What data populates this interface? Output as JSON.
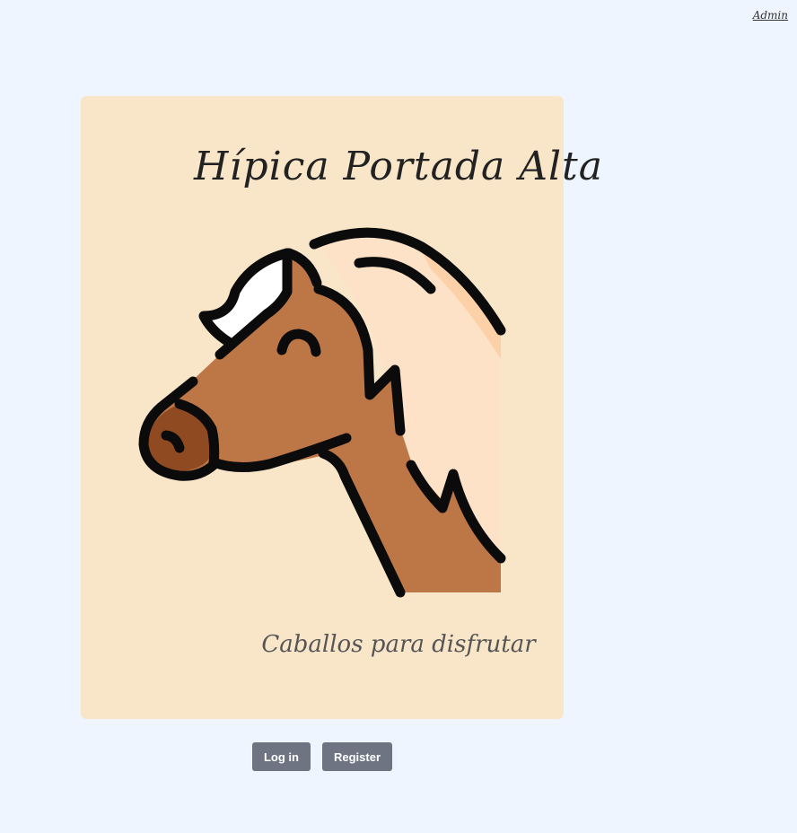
{
  "header": {
    "admin_link": "Admin"
  },
  "card": {
    "title": "Hípica Portada Alta",
    "subtitle": "Caballos para disfrutar",
    "image_icon": "horse-head-icon"
  },
  "actions": {
    "login_label": "Log in",
    "register_label": "Register"
  },
  "colors": {
    "page_background": "#eff5ff",
    "card_background": "#f9e6c9",
    "button_background": "#6e7482",
    "horse_body": "#bd7646",
    "horse_mane": "#fee2c7",
    "horse_nose": "#8f4a22",
    "outline": "#0b0b0b"
  }
}
